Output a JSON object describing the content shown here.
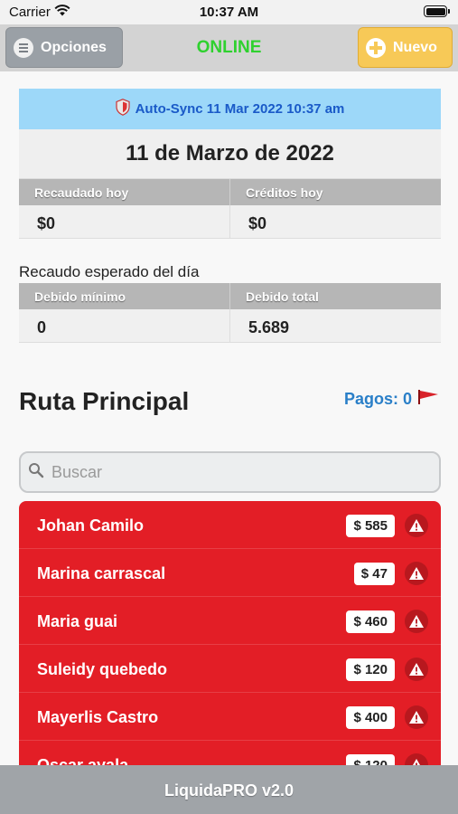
{
  "status_bar": {
    "carrier": "Carrier",
    "time": "10:37 AM"
  },
  "nav": {
    "options_label": "Opciones",
    "status": "ONLINE",
    "new_label": "Nuevo"
  },
  "sync": {
    "text": "Auto-Sync 11 Mar 2022 10:37 am"
  },
  "date": "11 de Marzo de 2022",
  "today": {
    "collected_label": "Recaudado hoy",
    "credits_label": "Créditos hoy",
    "collected_value": "$0",
    "credits_value": "$0"
  },
  "expected": {
    "title": "Recaudo esperado del día",
    "min_label": "Debido mínimo",
    "total_label": "Debido total",
    "min_value": "0",
    "total_value": "5.689"
  },
  "route": {
    "title": "Ruta Principal",
    "payments": "Pagos: 0"
  },
  "search": {
    "placeholder": "Buscar"
  },
  "clients": [
    {
      "name": "Johan Camilo",
      "amount": "$ 585"
    },
    {
      "name": "Marina carrascal",
      "amount": "$ 47"
    },
    {
      "name": "Maria guai",
      "amount": "$ 460"
    },
    {
      "name": "Suleidy quebedo",
      "amount": "$ 120"
    },
    {
      "name": "Mayerlis Castro",
      "amount": "$ 400"
    },
    {
      "name": "Oscar ayala",
      "amount": "$ 120"
    }
  ],
  "footer": "LiquidaPRO v2.0",
  "colors": {
    "online": "#2fd12f",
    "list_bg": "#e31e26",
    "sync_bg": "#9dd8f9",
    "accent_blue": "#2a7fc8",
    "new_button": "#f7c957"
  }
}
